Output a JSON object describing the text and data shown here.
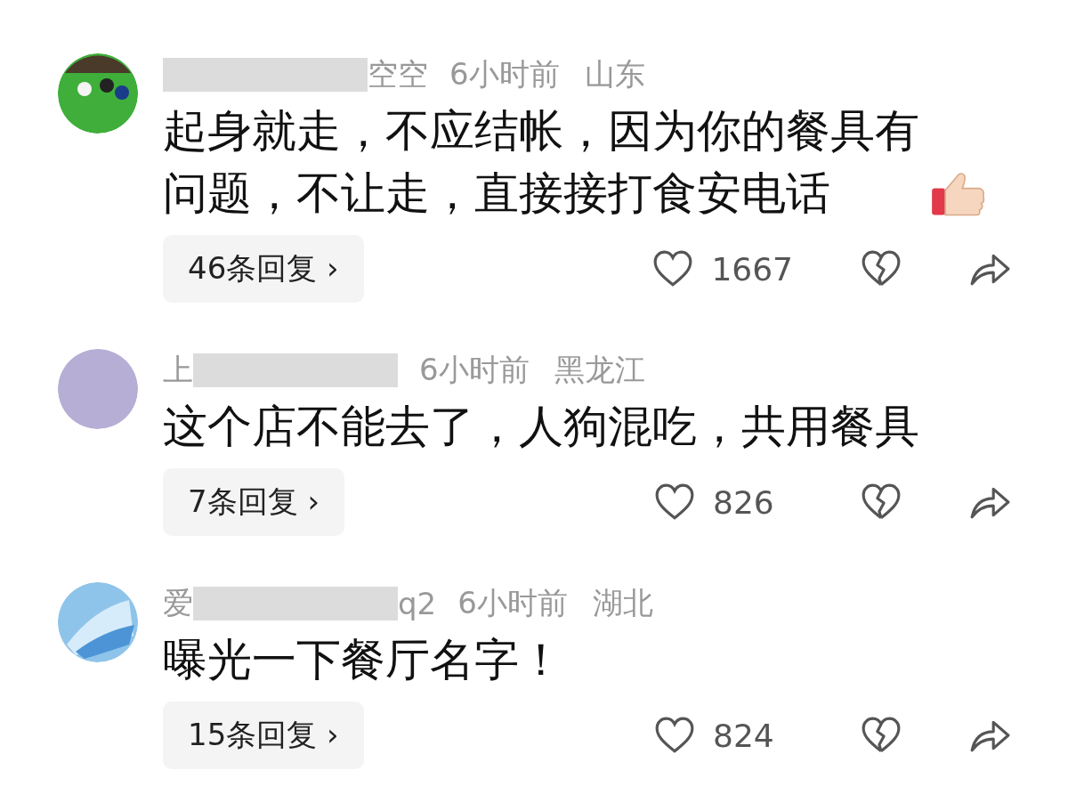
{
  "comments": [
    {
      "avatar": {
        "kind": "billiards"
      },
      "name_parts": [
        {
          "kind": "redaction"
        },
        {
          "kind": "text",
          "text": "空空"
        }
      ],
      "time": "6小时前",
      "location": "山东",
      "text": "起身就走，不应结帐，因为你的餐具有问题，不让走，直接接打食安电话",
      "emoji": {
        "kind": "thumbs-up"
      },
      "replies": "46条回复 ›",
      "likes": "1667"
    },
    {
      "avatar": {
        "kind": "lavender"
      },
      "name_parts": [
        {
          "kind": "text",
          "text": "上"
        },
        {
          "kind": "redaction"
        }
      ],
      "time": "6小时前",
      "location": "黑龙江",
      "text": "这个店不能去了，人狗混吃，共用餐具",
      "replies": "7条回复 ›",
      "likes": "826"
    },
    {
      "avatar": {
        "kind": "blue"
      },
      "name_parts": [
        {
          "kind": "text",
          "text": "爱"
        },
        {
          "kind": "redaction"
        },
        {
          "kind": "text",
          "text": "q2"
        }
      ],
      "time": "6小时前",
      "location": "湖北",
      "text": "曝光一下餐厅名字！",
      "replies": "15条回复 ›",
      "likes": "824"
    }
  ]
}
